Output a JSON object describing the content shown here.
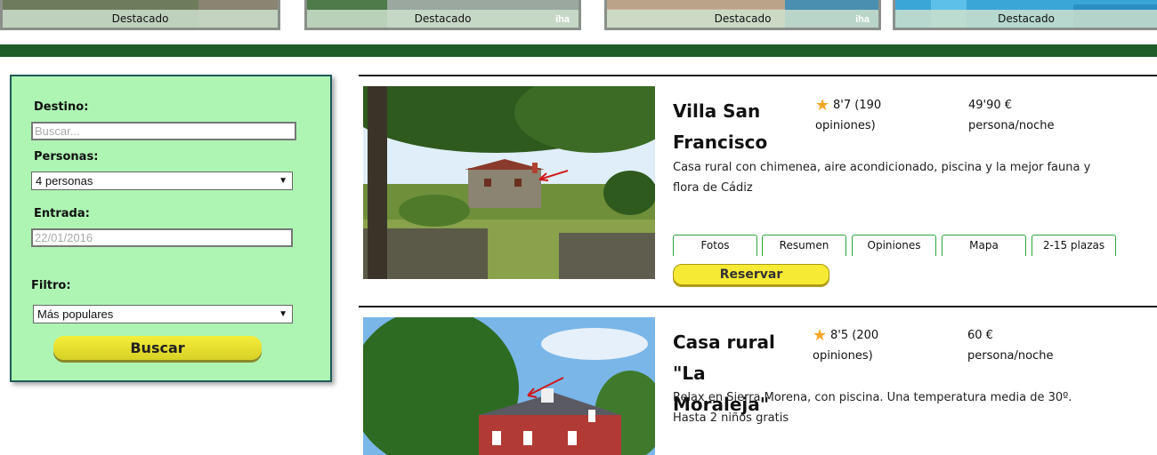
{
  "featured": {
    "items": [
      {
        "label": "Destacado",
        "logo": ""
      },
      {
        "label": "Destacado",
        "logo": "iha"
      },
      {
        "label": "Destacado",
        "logo": "iha"
      },
      {
        "label": "Destacado",
        "logo": ""
      }
    ]
  },
  "search": {
    "destino_label": "Destino:",
    "destino_placeholder": "Buscar...",
    "personas_label": "Personas:",
    "personas_value": "4 personas",
    "entrada_label": "Entrada:",
    "entrada_value": "22/01/2016",
    "filtro_label": "Filtro:",
    "filtro_value": "Más populares",
    "buscar_label": "Buscar"
  },
  "listings": [
    {
      "title": "Villa San Francisco",
      "rating_text": "8'7 (190 opiniones)",
      "price_text": "49'90 € persona/noche",
      "description": "Casa rural con chimenea, aire acondicionado, piscina y la mejor fauna y flora de Cádiz",
      "tabs": [
        "Fotos",
        "Resumen",
        "Opiniones",
        "Mapa",
        "2-15 plazas"
      ],
      "reservar_label": "Reservar"
    },
    {
      "title": "Casa rural \"La Moraleja\"",
      "rating_text": "8'5 (200 opiniones)",
      "price_text": "60 € persona/noche",
      "description": "Relax en Sierra Morena, con piscina. Una temperatura media de 30º. Hasta 2 niños gratis"
    }
  ],
  "colors": {
    "panel_bg": "#aef5b3",
    "header_bar": "#1e5c2a",
    "button_yellow": "#f7ea34",
    "tab_border": "#2aa43a",
    "star": "#f4a623"
  }
}
